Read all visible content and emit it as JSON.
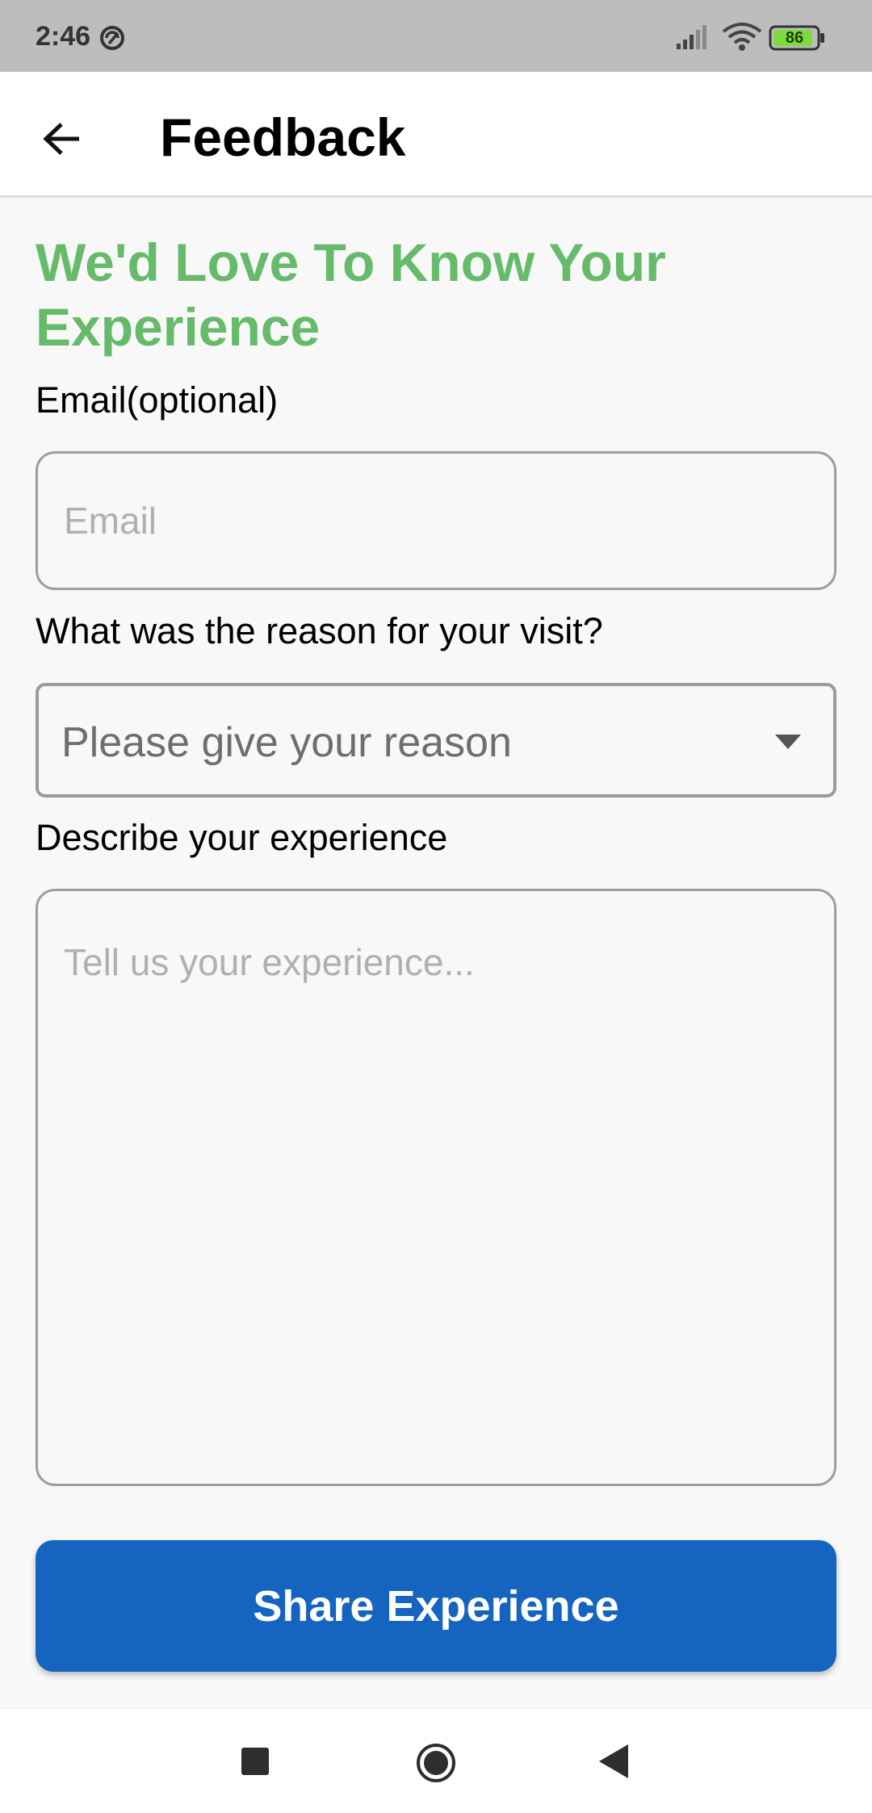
{
  "status_bar": {
    "time": "2:46",
    "battery": "86",
    "icons": [
      "sync-icon",
      "signal-icon",
      "wifi-icon",
      "battery-icon"
    ]
  },
  "app_bar": {
    "back_icon": "arrow-left-icon",
    "title": "Feedback"
  },
  "form": {
    "heading": "We'd Love To Know Your Experience",
    "email": {
      "label": "Email(optional)",
      "placeholder": "Email",
      "value": ""
    },
    "reason": {
      "label": "What was the reason for your visit?",
      "selected": "Please give your reason",
      "icon": "dropdown-arrow-icon"
    },
    "experience": {
      "label": "Describe your experience",
      "placeholder": "Tell us your experience...",
      "value": ""
    },
    "submit_label": "Share Experience"
  },
  "nav_bar": {
    "icons": [
      "recents-icon",
      "home-icon",
      "back-icon"
    ]
  },
  "colors": {
    "heading": "#66bb6a",
    "button": "#1565c0",
    "status_bar": "#bdbdbd"
  }
}
